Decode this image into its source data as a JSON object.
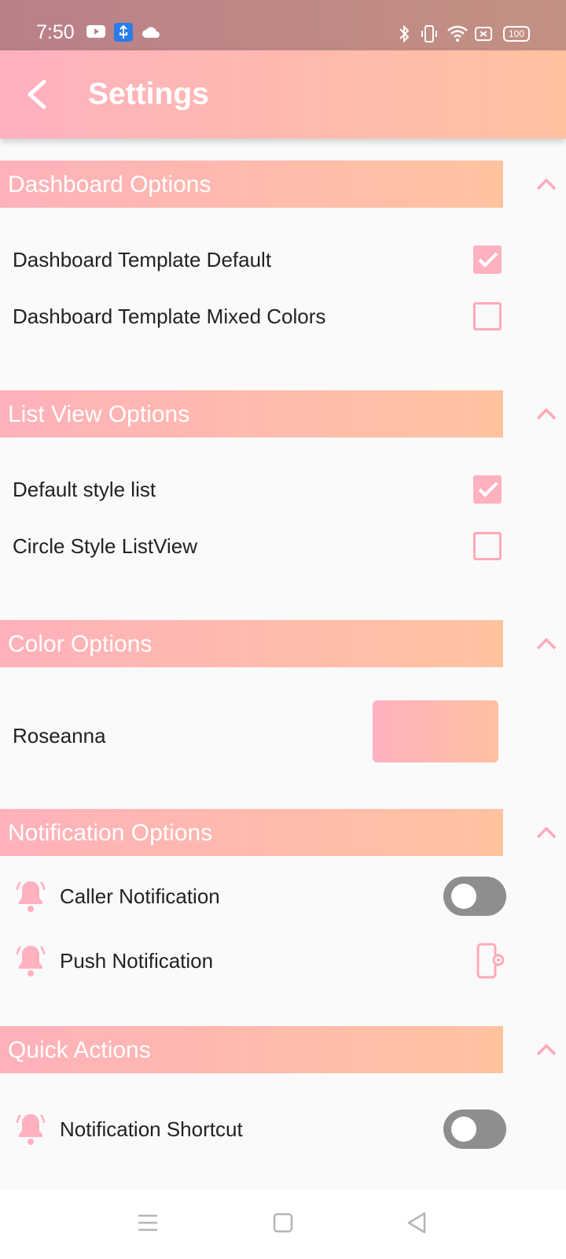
{
  "status_bar": {
    "time": "7:50",
    "icons": [
      "youtube-icon",
      "usb-icon",
      "cloud-icon",
      "bluetooth-icon",
      "vibrate-icon",
      "wifi-icon",
      "sim-icon",
      "battery-icon"
    ],
    "battery": "100"
  },
  "app_bar": {
    "title": "Settings",
    "back_icon": "chevron-left-icon"
  },
  "sections": {
    "dashboard": {
      "title": "Dashboard Options",
      "items": [
        {
          "label": "Dashboard Template Default",
          "checked": true
        },
        {
          "label": "Dashboard Template Mixed Colors",
          "checked": false
        }
      ]
    },
    "list_view": {
      "title": "List View Options",
      "items": [
        {
          "label": "Default style list",
          "checked": true
        },
        {
          "label": "Circle Style ListView",
          "checked": false
        }
      ]
    },
    "color": {
      "title": "Color Options",
      "color_name": "Roseanna",
      "swatch_colors": [
        "#ffb1c0",
        "#ffc0a0"
      ]
    },
    "notification": {
      "title": "Notification Options",
      "items": [
        {
          "label": "Caller Notification",
          "icon": "bell-icon",
          "control": "toggle",
          "enabled": false
        },
        {
          "label": "Push Notification",
          "icon": "bell-icon",
          "control": "phone-settings-icon"
        }
      ]
    },
    "quick_actions": {
      "title": "Quick Actions",
      "items": [
        {
          "label": "Notification Shortcut",
          "icon": "bell-icon",
          "control": "toggle",
          "enabled": false
        }
      ]
    }
  },
  "nav_bar": {
    "buttons": [
      "menu-icon",
      "home-icon",
      "back-icon"
    ]
  },
  "colors": {
    "accent_start": "#ffb1bf",
    "accent_end": "#ffc1a0",
    "toggle_off": "#8e8e8e",
    "text": "#222222"
  }
}
